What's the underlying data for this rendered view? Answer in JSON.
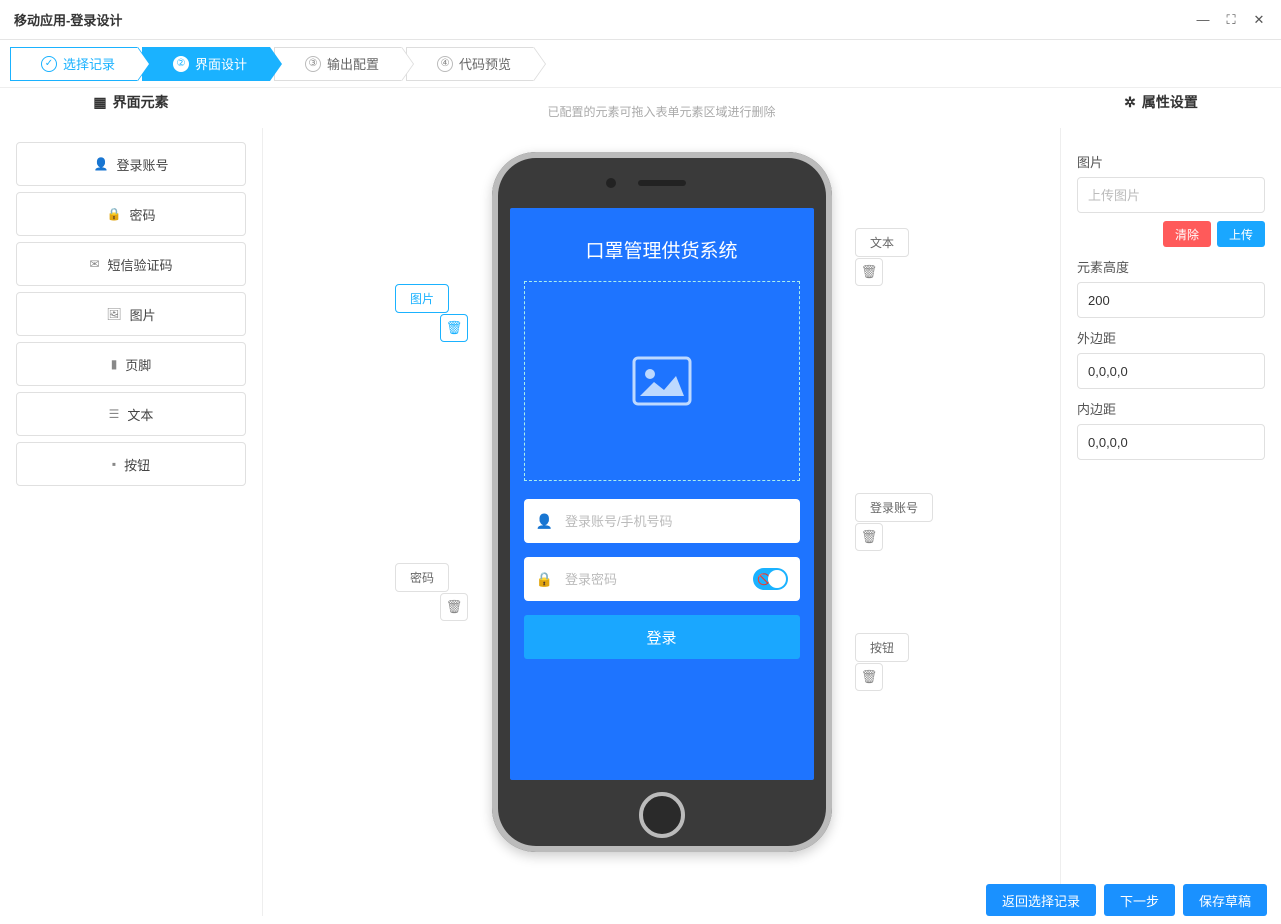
{
  "window": {
    "title": "移动应用-登录设计"
  },
  "steps": [
    {
      "num": "",
      "label": "选择记录",
      "state": "done",
      "check": true
    },
    {
      "num": "②",
      "label": "界面设计",
      "state": "active"
    },
    {
      "num": "③",
      "label": "输出配置",
      "state": ""
    },
    {
      "num": "④",
      "label": "代码预览",
      "state": ""
    }
  ],
  "left": {
    "title": "界面元素",
    "items": [
      {
        "icon": "user",
        "label": "登录账号"
      },
      {
        "icon": "lock",
        "label": "密码"
      },
      {
        "icon": "mail",
        "label": "短信验证码"
      },
      {
        "icon": "image",
        "label": "图片"
      },
      {
        "icon": "footer",
        "label": "页脚"
      },
      {
        "icon": "text",
        "label": "文本"
      },
      {
        "icon": "button",
        "label": "按钮"
      }
    ]
  },
  "canvas": {
    "hint": "已配置的元素可拖入表单元素区域进行删除",
    "app_title": "口罩管理供货系统",
    "login_field_placeholder": "登录账号/手机号码",
    "password_field_placeholder": "登录密码",
    "login_button": "登录",
    "tags": {
      "image": "图片",
      "password": "密码",
      "text": "文本",
      "account": "登录账号",
      "button": "按钮"
    }
  },
  "right": {
    "title": "属性设置",
    "image_label": "图片",
    "upload_placeholder": "上传图片",
    "clear_btn": "清除",
    "upload_btn": "上传",
    "height_label": "元素高度",
    "height_value": "200",
    "margin_label": "外边距",
    "margin_value": "0,0,0,0",
    "padding_label": "内边距",
    "padding_value": "0,0,0,0"
  },
  "footer": {
    "back": "返回选择记录",
    "next": "下一步",
    "save": "保存草稿"
  }
}
